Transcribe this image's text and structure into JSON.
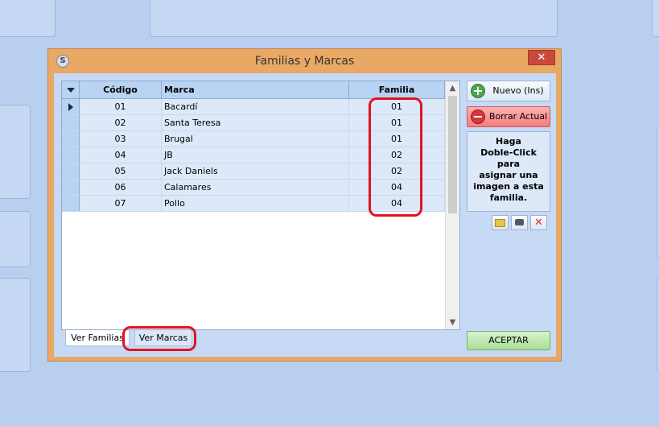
{
  "window": {
    "title": "Familias y Marcas",
    "app_icon": "S",
    "close_glyph": "✕"
  },
  "grid": {
    "columns": {
      "codigo": "Código",
      "marca": "Marca",
      "familia": "Familia"
    },
    "rows": [
      {
        "codigo": "01",
        "marca": "Bacardí",
        "familia": "01"
      },
      {
        "codigo": "02",
        "marca": "Santa Teresa",
        "familia": "01"
      },
      {
        "codigo": "03",
        "marca": "Brugal",
        "familia": "01"
      },
      {
        "codigo": "04",
        "marca": "JB",
        "familia": "02"
      },
      {
        "codigo": "05",
        "marca": "Jack Daniels",
        "familia": "02"
      },
      {
        "codigo": "06",
        "marca": "Calamares",
        "familia": "04"
      },
      {
        "codigo": "07",
        "marca": "Pollo",
        "familia": "04"
      }
    ]
  },
  "tabs": {
    "families": "Ver Familias",
    "brands": "Ver Marcas"
  },
  "buttons": {
    "new": "Nuevo (Ins)",
    "delete": "Borrar Actual",
    "accept": "ACEPTAR"
  },
  "image_box": {
    "text": "Haga\nDoble-Click para\nasignar una\nimagen a esta\nfamilia."
  },
  "icons": {
    "new": "plus-circle-icon",
    "delete": "minus-circle-icon",
    "small_buttons": [
      "folder-icon",
      "camera-icon",
      "delete-x-icon"
    ]
  },
  "colors": {
    "window_frame": "#e9a964",
    "highlight": "#e0141e",
    "client": "#c6daf6"
  }
}
